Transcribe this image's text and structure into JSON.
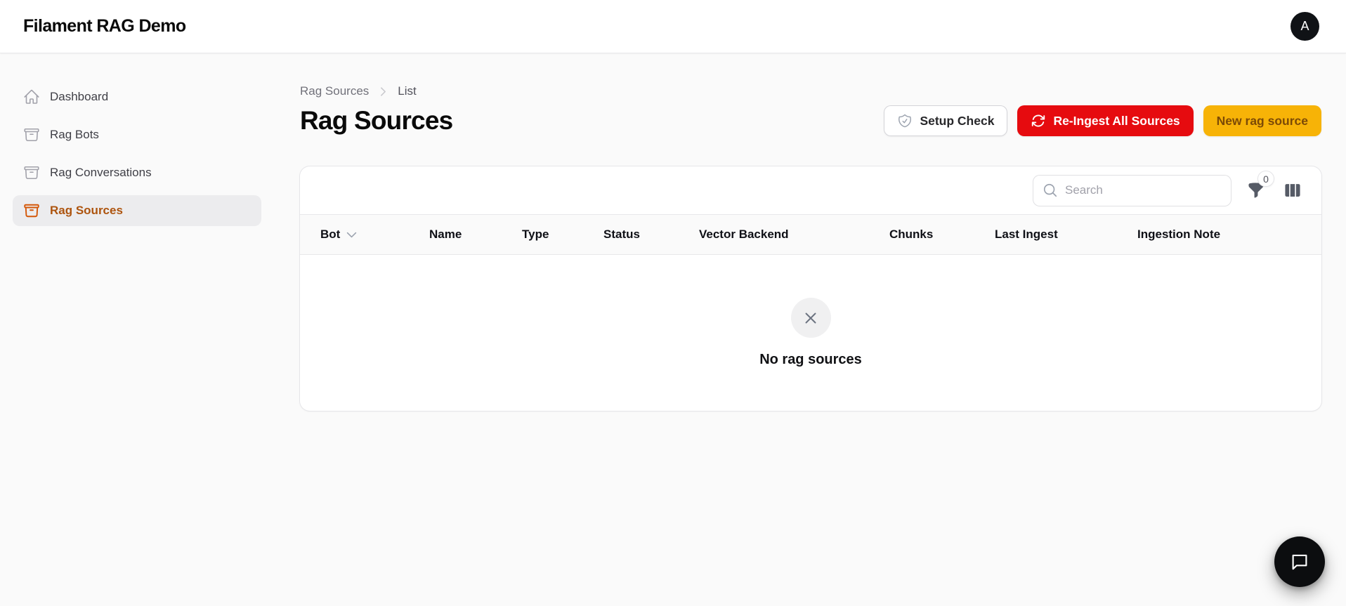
{
  "topbar": {
    "brand": "Filament RAG Demo",
    "avatar_initial": "A"
  },
  "sidebar": {
    "items": [
      {
        "label": "Dashboard",
        "icon": "home-icon",
        "active": false
      },
      {
        "label": "Rag Bots",
        "icon": "archive-box-icon",
        "active": false
      },
      {
        "label": "Rag Conversations",
        "icon": "archive-box-icon",
        "active": false
      },
      {
        "label": "Rag Sources",
        "icon": "archive-box-icon",
        "active": true
      }
    ]
  },
  "breadcrumb": {
    "parent": "Rag Sources",
    "current": "List"
  },
  "page": {
    "title": "Rag Sources"
  },
  "actions": {
    "setup_check": "Setup Check",
    "reingest_all": "Re-Ingest All Sources",
    "new_source": "New rag source"
  },
  "table": {
    "search_placeholder": "Search",
    "search_value": "",
    "filter_count": "0",
    "columns": [
      "Bot",
      "Name",
      "Type",
      "Status",
      "Vector Backend",
      "Chunks",
      "Last Ingest",
      "Ingestion Note"
    ],
    "sorted_column": "Bot",
    "rows": [],
    "empty_state_heading": "No rag sources"
  },
  "icons": {
    "toolbar": [
      "search-icon",
      "funnel-icon",
      "columns-icon"
    ],
    "empty_state": "x-mark-icon",
    "fab": "chat-bubble-icon"
  },
  "colors": {
    "danger_button": "#e60b0f",
    "warning_button": "#f7b307",
    "warning_button_text": "#7c4a06",
    "active_nav_icon": "#d45708",
    "active_nav_text": "#ad540e",
    "page_background": "#fafafa",
    "card_background": "#ffffff"
  }
}
